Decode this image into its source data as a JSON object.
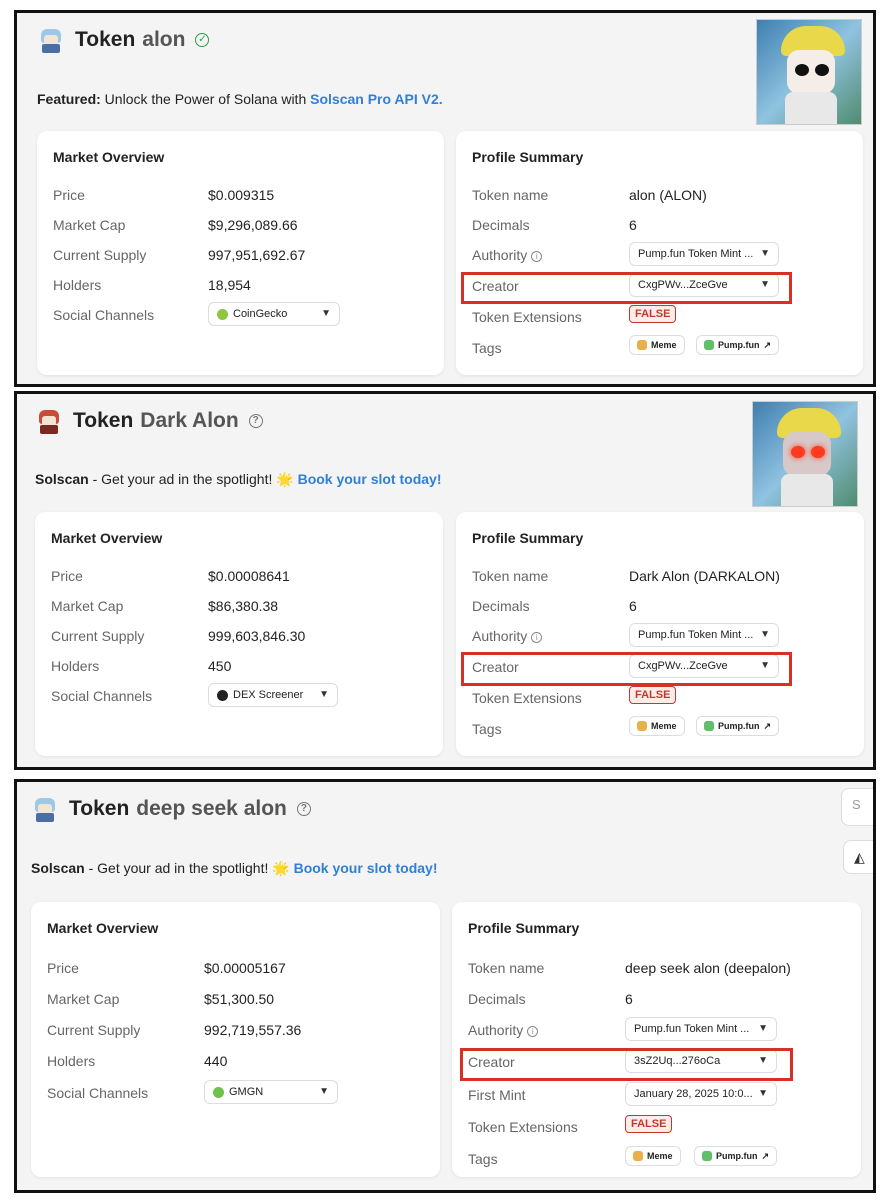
{
  "panels": [
    {
      "token_label": "Token",
      "name": "alon",
      "banner": {
        "prefix": "Featured:",
        "text": " Unlock the Power of Solana with ",
        "link": "Solscan Pro API V2."
      },
      "market": {
        "title": "Market Overview",
        "rows": [
          {
            "k": "Price",
            "v": "$0.009315"
          },
          {
            "k": "Market Cap",
            "v": "$9,296,089.66"
          },
          {
            "k": "Current Supply",
            "v": "997,951,692.67"
          },
          {
            "k": "Holders",
            "v": "18,954"
          }
        ],
        "social_label": "Social Channels",
        "social_value": "CoinGecko"
      },
      "profile": {
        "title": "Profile Summary",
        "token_name_label": "Token name",
        "token_name": "alon (ALON)",
        "decimals_label": "Decimals",
        "decimals": "6",
        "authority_label": "Authority",
        "authority": "Pump.fun Token Mint ...",
        "creator_label": "Creator",
        "creator": "CxgPWv...ZceGve",
        "ext_label": "Token Extensions",
        "ext": "FALSE",
        "tags_label": "Tags",
        "tag1": "Meme",
        "tag2": "Pump.fun"
      }
    },
    {
      "token_label": "Token",
      "name": "Dark Alon",
      "banner": {
        "prefix": "Solscan",
        "text": " - Get your ad in the spotlight! 🌟 ",
        "link": "Book your slot today!"
      },
      "market": {
        "title": "Market Overview",
        "rows": [
          {
            "k": "Price",
            "v": "$0.00008641"
          },
          {
            "k": "Market Cap",
            "v": "$86,380.38"
          },
          {
            "k": "Current Supply",
            "v": "999,603,846.30"
          },
          {
            "k": "Holders",
            "v": "450"
          }
        ],
        "social_label": "Social Channels",
        "social_value": "DEX Screener"
      },
      "profile": {
        "title": "Profile Summary",
        "token_name_label": "Token name",
        "token_name": "Dark Alon (DARKALON)",
        "decimals_label": "Decimals",
        "decimals": "6",
        "authority_label": "Authority",
        "authority": "Pump.fun Token Mint ...",
        "creator_label": "Creator",
        "creator": "CxgPWv...ZceGve",
        "ext_label": "Token Extensions",
        "ext": "FALSE",
        "tags_label": "Tags",
        "tag1": "Meme",
        "tag2": "Pump.fun"
      }
    },
    {
      "token_label": "Token",
      "name": "deep seek alon",
      "banner": {
        "prefix": "Solscan",
        "text": " - Get your ad in the spotlight! 🌟 ",
        "link": "Book your slot today!"
      },
      "market": {
        "title": "Market Overview",
        "rows": [
          {
            "k": "Price",
            "v": "$0.00005167"
          },
          {
            "k": "Market Cap",
            "v": "$51,300.50"
          },
          {
            "k": "Current Supply",
            "v": "992,719,557.36"
          },
          {
            "k": "Holders",
            "v": "440"
          }
        ],
        "social_label": "Social Channels",
        "social_value": "GMGN"
      },
      "profile": {
        "title": "Profile Summary",
        "token_name_label": "Token name",
        "token_name": "deep seek alon (deepalon)",
        "decimals_label": "Decimals",
        "decimals": "6",
        "authority_label": "Authority",
        "authority": "Pump.fun Token Mint ...",
        "creator_label": "Creator",
        "creator": "3sZ2Uq...276oCa",
        "first_mint_label": "First Mint",
        "first_mint": "January 28, 2025 10:0...",
        "ext_label": "Token Extensions",
        "ext": "FALSE",
        "tags_label": "Tags",
        "tag1": "Meme",
        "tag2": "Pump.fun"
      },
      "side_search": "S"
    }
  ],
  "colors": {
    "link": "#2f80d6",
    "highlight": "#d93025",
    "false_badge": "#c0392b"
  },
  "icons": [
    "verified-icon",
    "help-icon",
    "chevron-down-icon",
    "info-icon",
    "external-link-icon",
    "coingecko-icon",
    "dexscreener-icon",
    "gmgn-icon",
    "meme-icon",
    "pill-icon"
  ]
}
